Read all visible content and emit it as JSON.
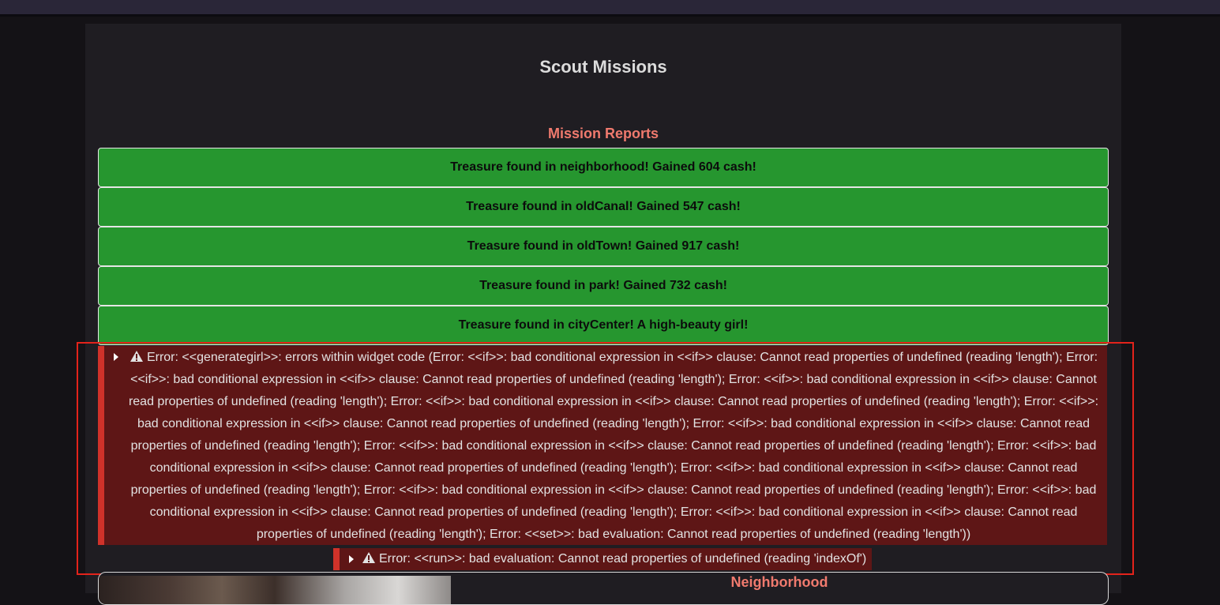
{
  "page": {
    "title": "Scout Missions",
    "section_title": "Mission Reports"
  },
  "reports": [
    "Treasure found in neighborhood! Gained 604 cash!",
    "Treasure found in oldCanal! Gained 547 cash!",
    "Treasure found in oldTown! Gained 917 cash!",
    "Treasure found in park! Gained 732 cash!",
    "Treasure found in cityCenter! A high-beauty girl!"
  ],
  "errors": {
    "main": "Error: <<generategirl>>: errors within widget code (Error: <<if>>: bad conditional expression in <<if>> clause: Cannot read properties of undefined (reading 'length'); Error: <<if>>: bad conditional expression in <<if>> clause: Cannot read properties of undefined (reading 'length'); Error: <<if>>: bad conditional expression in <<if>> clause: Cannot read properties of undefined (reading 'length'); Error: <<if>>: bad conditional expression in <<if>> clause: Cannot read properties of undefined (reading 'length'); Error: <<if>>: bad conditional expression in <<if>> clause: Cannot read properties of undefined (reading 'length'); Error: <<if>>: bad conditional expression in <<if>> clause: Cannot read properties of undefined (reading 'length'); Error: <<if>>: bad conditional expression in <<if>> clause: Cannot read properties of undefined (reading 'length'); Error: <<if>>: bad conditional expression in <<if>> clause: Cannot read properties of undefined (reading 'length'); Error: <<if>>: bad conditional expression in <<if>> clause: Cannot read properties of undefined (reading 'length'); Error: <<if>>: bad conditional expression in <<if>> clause: Cannot read properties of undefined (reading 'length'); Error: <<if>>: bad conditional expression in <<if>> clause: Cannot read properties of undefined (reading 'length'); Error: <<if>>: bad conditional expression in <<if>> clause: Cannot read properties of undefined (reading 'length'); Error: <<set>>: bad evaluation: Cannot read properties of undefined (reading 'length'))",
    "secondary": "Error: <<run>>: bad evaluation: Cannot read properties of undefined (reading 'indexOf')"
  },
  "location": {
    "title": "Neighborhood"
  },
  "colors": {
    "report_bg": "#26962f",
    "error_bg": "#5e1616",
    "error_accent": "#d0322a",
    "heading_accent": "#f07a6e",
    "highlight": "#e3231b"
  },
  "icons": {
    "toggle": "caret-right-icon",
    "warning": "warning-triangle-icon"
  }
}
